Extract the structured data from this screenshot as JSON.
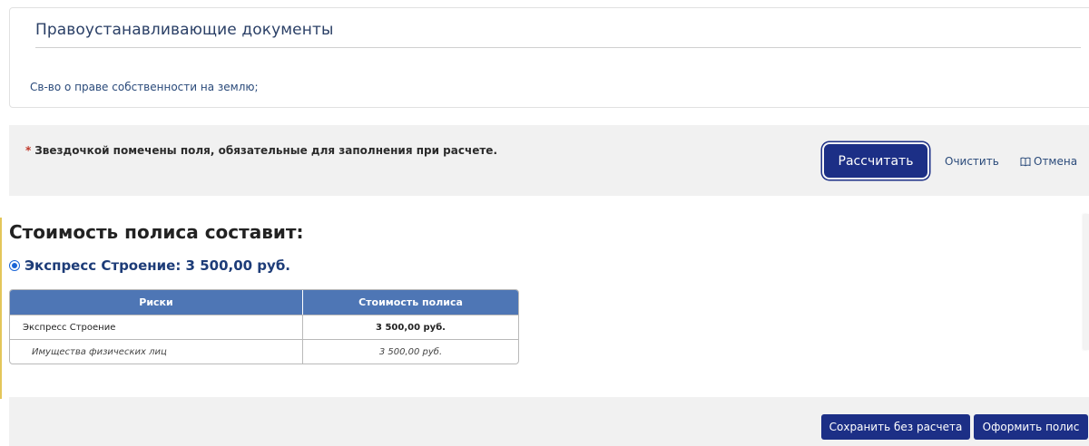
{
  "documents": {
    "title": "Правоустанавливающие документы",
    "items": [
      "Св-во о праве собственности на землю;"
    ]
  },
  "calc": {
    "note_asterisk": "*",
    "note": "Звездочкой помечены поля, обязательные для заполнения при расчете.",
    "calculate_label": "Рассчитать",
    "clear_label": "Очистить",
    "cancel_label": "Отмена",
    "cancel_icon": "book-icon"
  },
  "result": {
    "title": "Стоимость полиса составит:",
    "option_label": "Экспресс Строение: 3 500,00 руб.",
    "option_selected": true,
    "table": {
      "headers": [
        "Риски",
        "Стоимость полиса"
      ],
      "rows": [
        {
          "risk": "Экспресс Строение",
          "cost": "3 500,00 руб."
        },
        {
          "risk": "Имущества физических лиц",
          "cost": "3 500,00 руб."
        }
      ]
    }
  },
  "footer": {
    "save_label": "Сохранить без расчета",
    "issue_label": "Оформить полис"
  },
  "colors": {
    "primary_button": "#1c2f86",
    "table_header": "#4e76b5",
    "link": "#2a4a7a",
    "panel_bg": "#f1f1f1"
  }
}
